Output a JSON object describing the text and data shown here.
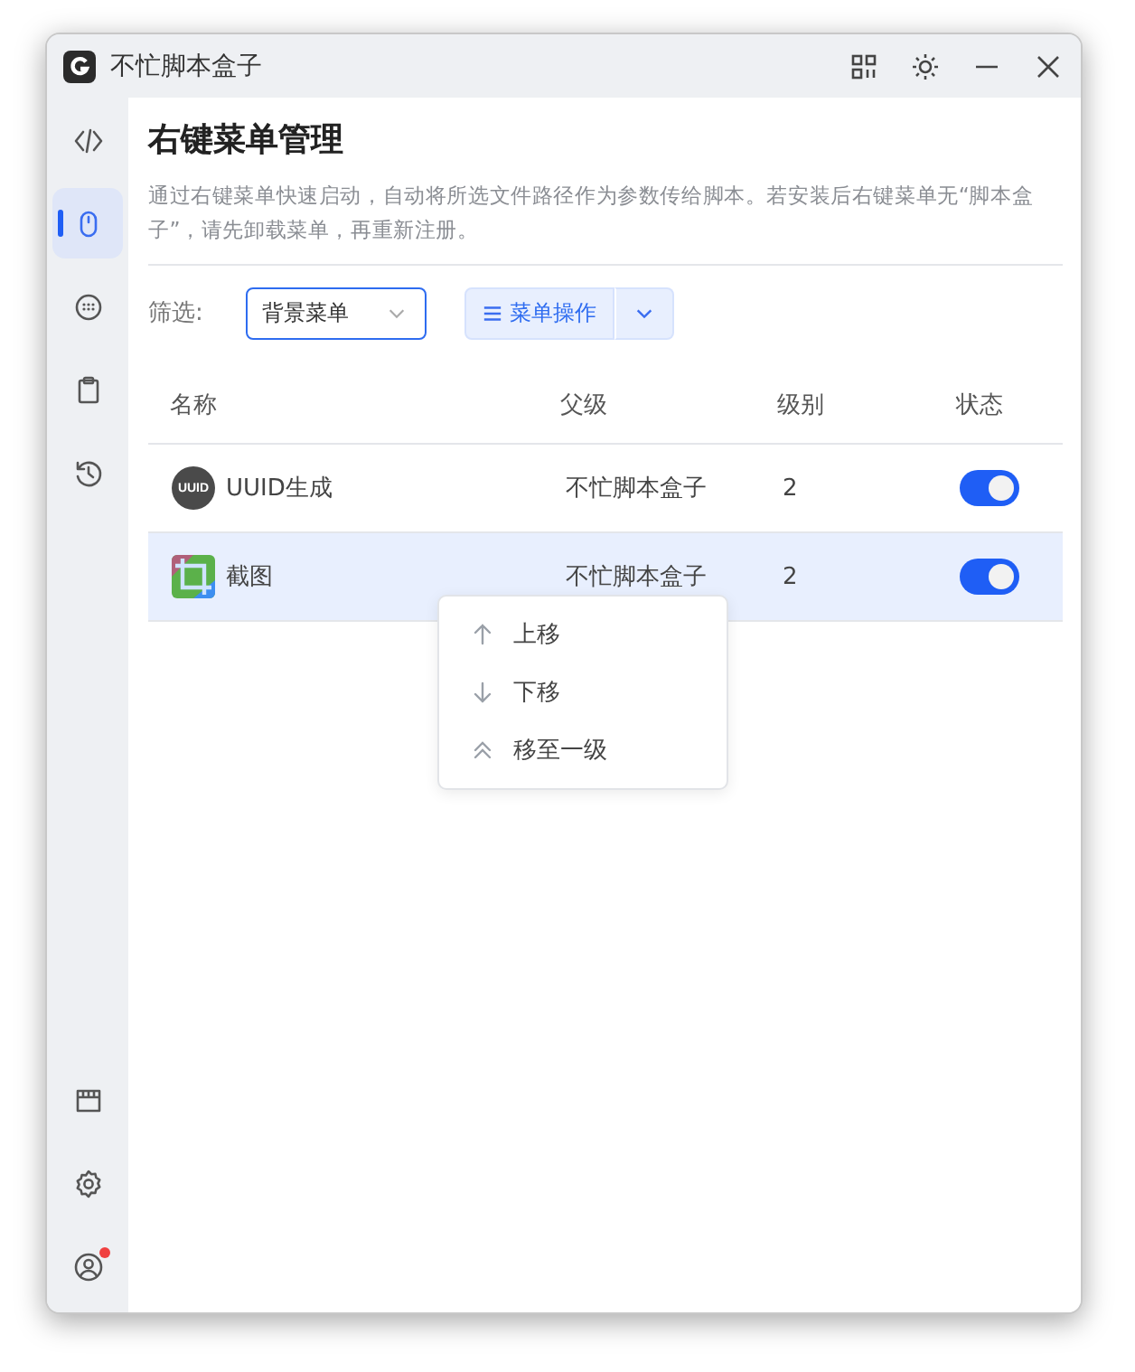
{
  "window": {
    "title": "不忙脚本盒子"
  },
  "sidebar": {
    "top_items": [
      {
        "kind": "code",
        "selected": false
      },
      {
        "kind": "mouse",
        "selected": true
      },
      {
        "kind": "keypad",
        "selected": false
      },
      {
        "kind": "clipboard",
        "selected": false
      },
      {
        "kind": "history",
        "selected": false
      }
    ],
    "bottom_items": [
      {
        "kind": "store",
        "selected": false,
        "badge": false
      },
      {
        "kind": "settings",
        "selected": false,
        "badge": false
      },
      {
        "kind": "user",
        "selected": false,
        "badge": true
      }
    ]
  },
  "page": {
    "title": "右键菜单管理",
    "description": "通过右键菜单快速启动，自动将所选文件路径作为参数传给脚本。若安装后右键菜单无“脚本盒子”，请先卸载菜单，再重新注册。"
  },
  "filter": {
    "label": "筛选:",
    "value": "背景菜单"
  },
  "action_button": {
    "label": "菜单操作"
  },
  "table": {
    "columns": [
      "名称",
      "父级",
      "级别",
      "状态"
    ],
    "rows": [
      {
        "icon": {
          "kind": "badge",
          "text": "UUID"
        },
        "name": "UUID生成",
        "parent": "不忙脚本盒子",
        "level": "2",
        "enabled": true,
        "selected": false
      },
      {
        "name": "截图",
        "parent": "不忙脚本盒子",
        "level": "2",
        "enabled": true,
        "selected": true
      }
    ]
  },
  "context_menu": {
    "items": [
      {
        "kind": "up",
        "label": "上移"
      },
      {
        "kind": "down",
        "label": "下移"
      },
      {
        "kind": "top",
        "label": "移至一级"
      }
    ]
  }
}
